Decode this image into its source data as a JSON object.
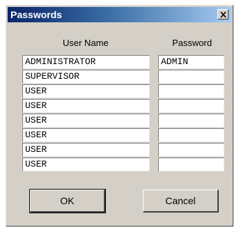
{
  "window": {
    "title": "Passwords",
    "close_icon": "close-x-icon"
  },
  "headers": {
    "user_name": "User Name",
    "password": "Password"
  },
  "users": [
    "ADMINISTRATOR",
    "SUPERVISOR",
    "USER",
    "USER",
    "USER",
    "USER",
    "USER",
    "USER"
  ],
  "passwords": [
    "ADMIN",
    "",
    "",
    "",
    "",
    "",
    "",
    ""
  ],
  "buttons": {
    "ok": "OK",
    "cancel": "Cancel"
  }
}
